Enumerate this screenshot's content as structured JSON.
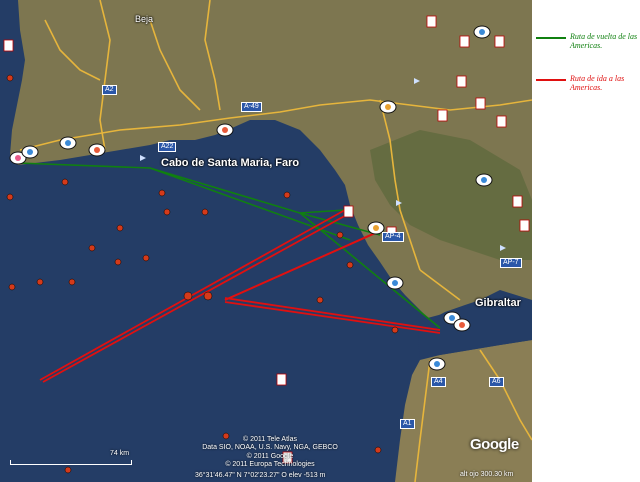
{
  "legend": {
    "return_route": {
      "text": "Ruta de vuelta de las Americas.",
      "color": "#108010"
    },
    "outbound_route": {
      "text": "Ruta de ida a las Americas.",
      "color": "#e01010"
    }
  },
  "places": {
    "beja": "Beja",
    "cabo": "Cabo de Santa Maria, Faro",
    "gibraltar": "Gibraltar"
  },
  "roads": [
    "A2",
    "A-49",
    "A22",
    "AP-4",
    "AP-7",
    "A4",
    "A6",
    "A1"
  ],
  "credits": [
    "© 2011 Tele Atlas",
    "Data SIO, NOAA, U.S. Navy, NGA, GEBCO",
    "© 2011 Google",
    "© 2011 Europa Technologies"
  ],
  "status_bar": {
    "coords": "36°31'46.47\" N    7°02'23.27\" O   elev  -513 m",
    "eye_alt": "alt ojo 300.30 km"
  },
  "scale_label": "74 km",
  "brand": "Google",
  "colors": {
    "sea": "#223a63",
    "land": "#7f7a5a",
    "return_route": "#108010",
    "outbound_route": "#e01010",
    "roads": "#e6b53c"
  },
  "icons": [
    "youtube-icon",
    "photo-marker-icon",
    "airport-icon",
    "shipwreck-marker-icon"
  ]
}
